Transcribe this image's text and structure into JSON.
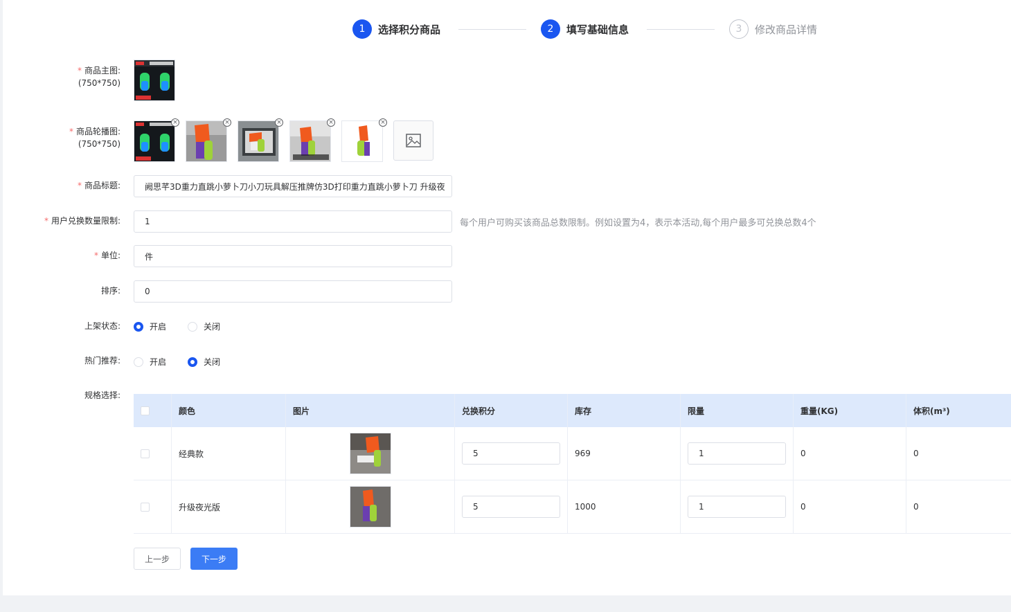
{
  "steps": [
    {
      "num": "1",
      "title": "选择积分商品",
      "state": "active"
    },
    {
      "num": "2",
      "title": "填写基础信息",
      "state": "active"
    },
    {
      "num": "3",
      "title": "修改商品详情",
      "state": "inactive"
    }
  ],
  "form": {
    "main_image_label": "商品主图:",
    "main_image_size": "(750*750)",
    "carousel_label": "商品轮播图:",
    "carousel_size": "(750*750)",
    "title_label": "商品标题:",
    "title_value": "阙思芊3D重力直跳小萝卜刀小刀玩具解压推牌仿3D打印重力直跳小萝卜刀 升级夜",
    "limit_label": "用户兑换数量限制:",
    "limit_value": "1",
    "limit_hint": "每个用户可购买该商品总数限制。例如设置为4，表示本活动,每个用户最多可兑换总数4个",
    "unit_label": "单位:",
    "unit_value": "件",
    "sort_label": "排序:",
    "sort_value": "0",
    "shelf_label": "上架状态:",
    "shelf_on": "开启",
    "shelf_off": "关闭",
    "shelf_selected": "on",
    "hot_label": "热门推荐:",
    "hot_on": "开启",
    "hot_off": "关闭",
    "hot_selected": "off",
    "spec_label": "规格选择:"
  },
  "spec_table": {
    "headers": [
      "颜色",
      "图片",
      "兑换积分",
      "库存",
      "限量",
      "重量(KG)",
      "体积(m³)"
    ],
    "rows": [
      {
        "color": "经典款",
        "points": "5",
        "stock": "969",
        "limit": "1",
        "weight": "0",
        "volume": "0"
      },
      {
        "color": "升级夜光版",
        "points": "5",
        "stock": "1000",
        "limit": "1",
        "weight": "0",
        "volume": "0"
      }
    ]
  },
  "buttons": {
    "prev": "上一步",
    "next": "下一步"
  },
  "colors": {
    "primary": "#1a56f0",
    "button_primary": "#3b7cf5",
    "required": "#f56c6c",
    "table_header": "#dde9fc"
  }
}
